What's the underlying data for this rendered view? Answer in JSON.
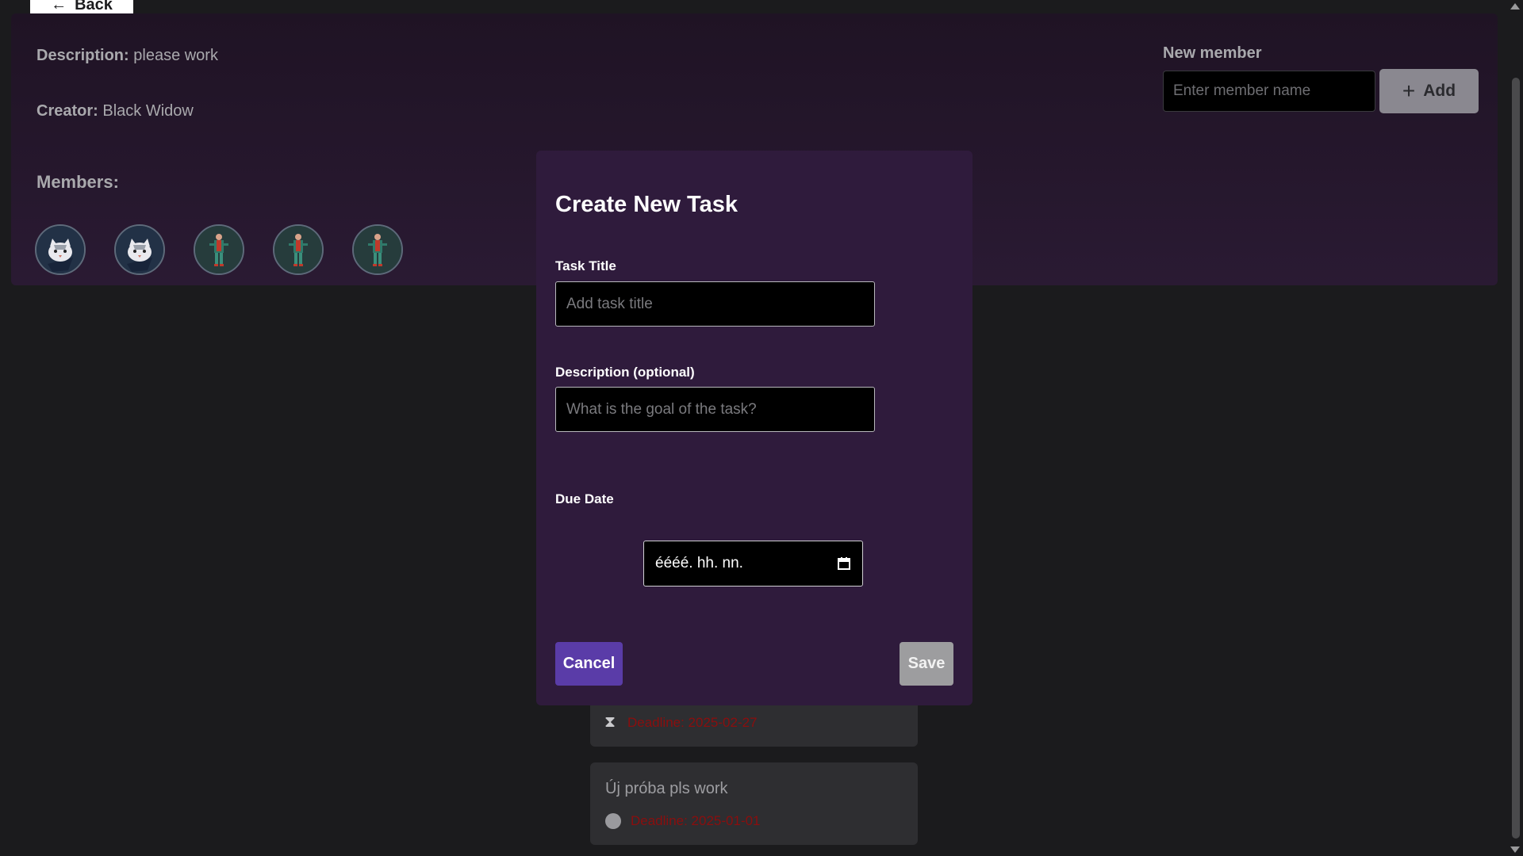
{
  "back_button": {
    "label": "Back"
  },
  "project": {
    "description_label": "Description:",
    "description_value": "please work",
    "creator_label": "Creator:",
    "creator_value": "Black Widow",
    "members_label": "Members:"
  },
  "members": [
    {
      "avatar": "cat-avatar"
    },
    {
      "avatar": "cat-avatar"
    },
    {
      "avatar": "character-avatar"
    },
    {
      "avatar": "character-avatar"
    },
    {
      "avatar": "character-avatar"
    }
  ],
  "new_member": {
    "title": "New member",
    "placeholder": "Enter member name",
    "add_label": "Add"
  },
  "modal": {
    "title": "Create New Task",
    "task_title_label": "Task Title",
    "task_title_placeholder": "Add task title",
    "description_label": "Description (optional)",
    "description_placeholder": "What is the goal of the task?",
    "due_date_label": "Due Date",
    "date_placeholder": "éééé. hh. nn.",
    "cancel_label": "Cancel",
    "save_label": "Save"
  },
  "tasks": [
    {
      "title": "",
      "deadline": "Deadline: 2025-02-27",
      "status_icon": "hourglass-icon"
    },
    {
      "title": "Új próba pls work",
      "deadline": "Deadline: 2025-01-01",
      "status_icon": "circle-icon"
    }
  ],
  "colors": {
    "accent": "#5a3ca8",
    "deadline": "#8b0e0e",
    "modal_bg": "#2f1b3c"
  }
}
